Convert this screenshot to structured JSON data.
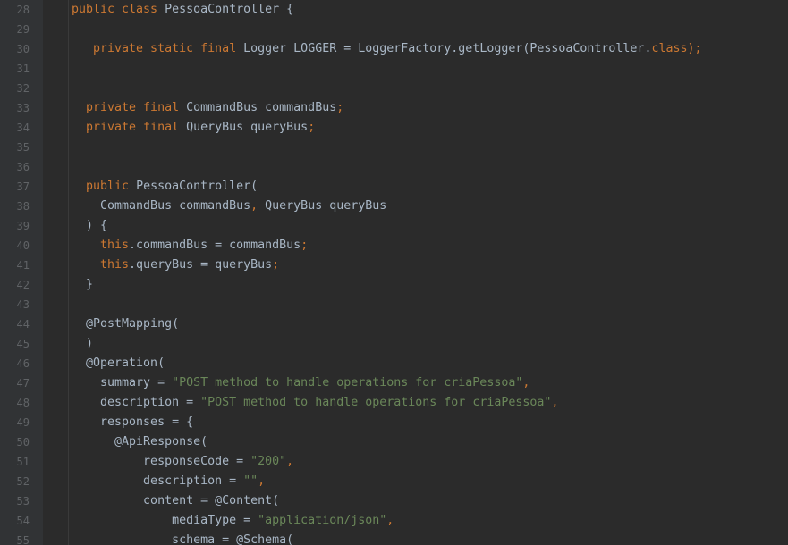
{
  "editor": {
    "language": "Java",
    "colors": {
      "background": "#2b2b2b",
      "keyword": "#cc7832",
      "string": "#6a8759",
      "text": "#a9b7c6",
      "line_number": "#606366"
    },
    "lines": [
      {
        "n": "28",
        "tokens": [
          {
            "t": "public class ",
            "c": "kw"
          },
          {
            "t": "PessoaController {",
            "c": "plain"
          }
        ]
      },
      {
        "n": "29",
        "tokens": []
      },
      {
        "n": "30",
        "tokens": [
          {
            "t": "   private static final ",
            "c": "kw"
          },
          {
            "t": "Logger LOGGER = LoggerFactory.getLogger(PessoaController.",
            "c": "plain"
          },
          {
            "t": "class",
            "c": "kw"
          },
          {
            "t": ");",
            "c": "kw"
          }
        ]
      },
      {
        "n": "31",
        "tokens": []
      },
      {
        "n": "32",
        "tokens": []
      },
      {
        "n": "33",
        "tokens": [
          {
            "t": "  private final ",
            "c": "kw"
          },
          {
            "t": "CommandBus commandBus",
            "c": "plain"
          },
          {
            "t": ";",
            "c": "kw"
          }
        ]
      },
      {
        "n": "34",
        "tokens": [
          {
            "t": "  private final ",
            "c": "kw"
          },
          {
            "t": "QueryBus queryBus",
            "c": "plain"
          },
          {
            "t": ";",
            "c": "kw"
          }
        ]
      },
      {
        "n": "35",
        "tokens": []
      },
      {
        "n": "36",
        "tokens": []
      },
      {
        "n": "37",
        "tokens": [
          {
            "t": "  public ",
            "c": "kw"
          },
          {
            "t": "PessoaController(",
            "c": "plain"
          }
        ]
      },
      {
        "n": "38",
        "tokens": [
          {
            "t": "    CommandBus commandBus",
            "c": "plain"
          },
          {
            "t": ", ",
            "c": "kw"
          },
          {
            "t": "QueryBus queryBus",
            "c": "plain"
          }
        ]
      },
      {
        "n": "39",
        "tokens": [
          {
            "t": "  ) {",
            "c": "plain"
          }
        ]
      },
      {
        "n": "40",
        "tokens": [
          {
            "t": "    this",
            "c": "kw"
          },
          {
            "t": ".commandBus = commandBus",
            "c": "plain"
          },
          {
            "t": ";",
            "c": "kw"
          }
        ]
      },
      {
        "n": "41",
        "tokens": [
          {
            "t": "    this",
            "c": "kw"
          },
          {
            "t": ".queryBus = queryBus",
            "c": "plain"
          },
          {
            "t": ";",
            "c": "kw"
          }
        ]
      },
      {
        "n": "42",
        "tokens": [
          {
            "t": "  }",
            "c": "plain"
          }
        ]
      },
      {
        "n": "43",
        "tokens": []
      },
      {
        "n": "44",
        "tokens": [
          {
            "t": "  @PostMapping(",
            "c": "plain"
          }
        ]
      },
      {
        "n": "45",
        "tokens": [
          {
            "t": "  )",
            "c": "plain"
          }
        ]
      },
      {
        "n": "46",
        "tokens": [
          {
            "t": "  @Operation(",
            "c": "plain"
          }
        ]
      },
      {
        "n": "47",
        "tokens": [
          {
            "t": "    summary = ",
            "c": "plain"
          },
          {
            "t": "\"POST method to handle operations for criaPessoa\"",
            "c": "str"
          },
          {
            "t": ",",
            "c": "kw"
          }
        ]
      },
      {
        "n": "48",
        "tokens": [
          {
            "t": "    description = ",
            "c": "plain"
          },
          {
            "t": "\"POST method to handle operations for criaPessoa\"",
            "c": "str"
          },
          {
            "t": ",",
            "c": "kw"
          }
        ]
      },
      {
        "n": "49",
        "tokens": [
          {
            "t": "    responses = {",
            "c": "plain"
          }
        ]
      },
      {
        "n": "50",
        "tokens": [
          {
            "t": "      @ApiResponse(",
            "c": "plain"
          }
        ]
      },
      {
        "n": "51",
        "tokens": [
          {
            "t": "          responseCode = ",
            "c": "plain"
          },
          {
            "t": "\"200\"",
            "c": "str"
          },
          {
            "t": ",",
            "c": "kw"
          }
        ]
      },
      {
        "n": "52",
        "tokens": [
          {
            "t": "          description = ",
            "c": "plain"
          },
          {
            "t": "\"\"",
            "c": "str"
          },
          {
            "t": ",",
            "c": "kw"
          }
        ]
      },
      {
        "n": "53",
        "tokens": [
          {
            "t": "          content = @Content(",
            "c": "plain"
          }
        ]
      },
      {
        "n": "54",
        "tokens": [
          {
            "t": "              mediaType = ",
            "c": "plain"
          },
          {
            "t": "\"application/json\"",
            "c": "str"
          },
          {
            "t": ",",
            "c": "kw"
          }
        ]
      },
      {
        "n": "55",
        "tokens": [
          {
            "t": "              schema = @Schema(",
            "c": "plain"
          }
        ]
      }
    ]
  }
}
